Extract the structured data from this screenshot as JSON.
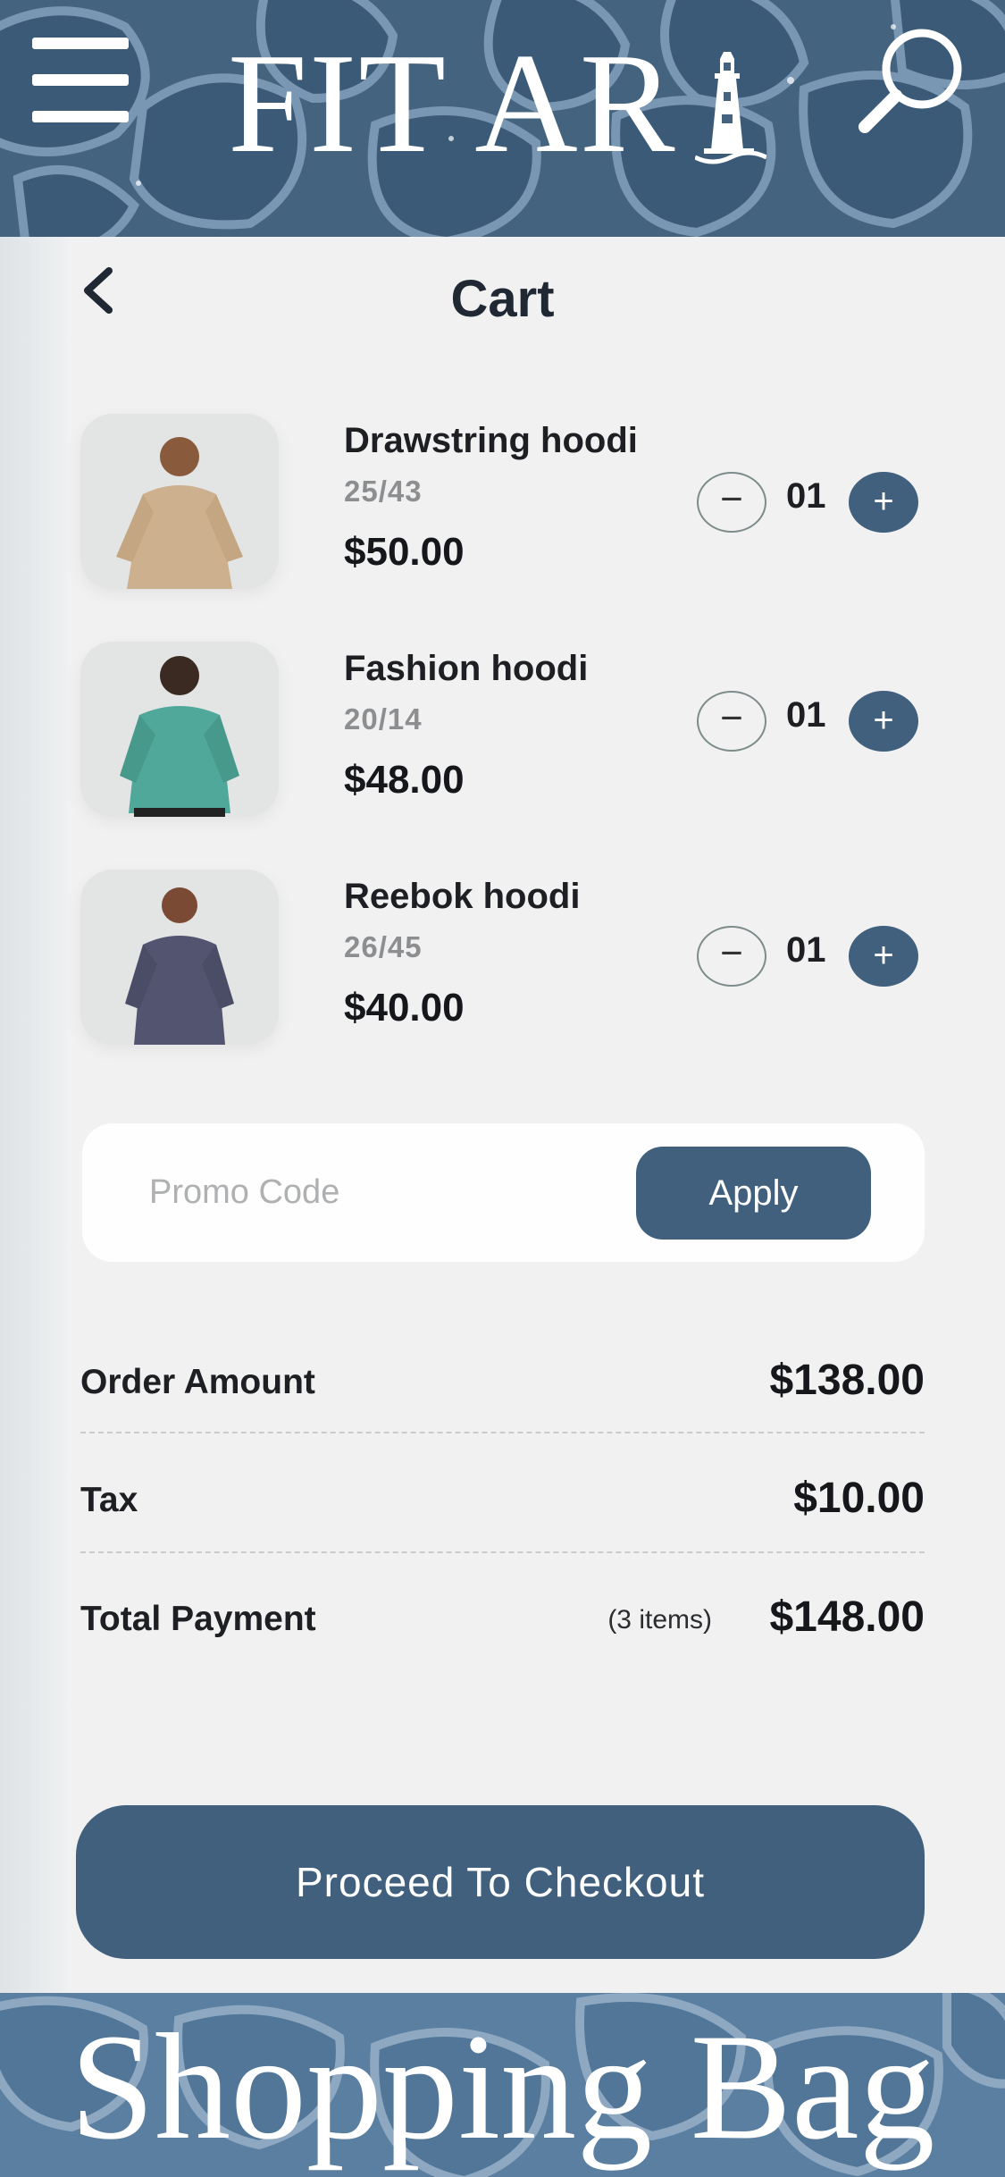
{
  "header": {
    "brand": "FIT AR",
    "menu_icon": "hamburger-menu-icon",
    "search_icon": "magnifier-search-icon",
    "brand_icon": "lighthouse-icon"
  },
  "page": {
    "title": "Cart",
    "back_icon": "chevron-left-icon"
  },
  "cart": {
    "items": [
      {
        "name": "Drawstring hoodi",
        "size": "25/43",
        "price": "$50.00",
        "qty": "01",
        "hoodie_color": "#cdb08e"
      },
      {
        "name": "Fashion hoodi",
        "size": "20/14",
        "price": "$48.00",
        "qty": "01",
        "hoodie_color": "#4fa89a"
      },
      {
        "name": "Reebok hoodi",
        "size": "26/45",
        "price": "$40.00",
        "qty": "01",
        "hoodie_color": "#53546f"
      }
    ],
    "minus_symbol": "−",
    "plus_symbol": "+"
  },
  "promo": {
    "placeholder": "Promo Code",
    "apply_label": "Apply"
  },
  "summary": {
    "order_label": "Order Amount",
    "order_value": "$138.00",
    "tax_label": "Tax",
    "tax_value": "$10.00",
    "total_label": "Total Payment",
    "total_count": "(3 items)",
    "total_value": "$148.00"
  },
  "checkout": {
    "label": "Proceed To Checkout"
  },
  "footer": {
    "title": "Shopping Bag"
  },
  "colors": {
    "accent": "#40607d",
    "header_bg": "#43637f",
    "footer_bg": "#5a7fa1",
    "card_bg": "#f1f1f2"
  }
}
